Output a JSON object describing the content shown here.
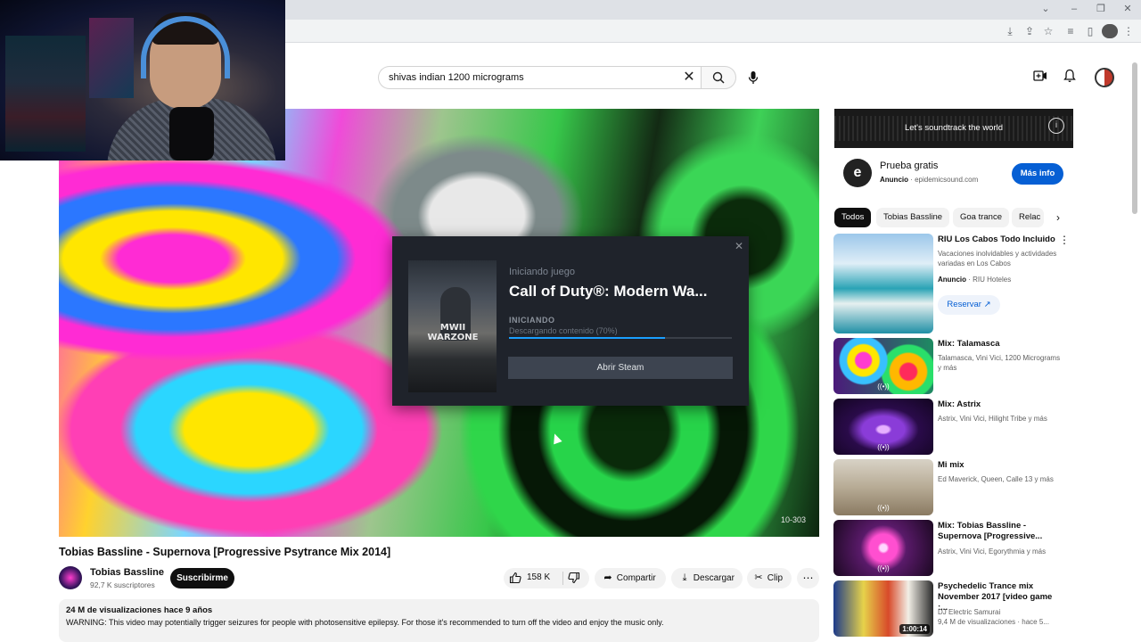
{
  "search": {
    "value": "shivas indian 1200 micrograms"
  },
  "player": {
    "watermark": "10-303"
  },
  "steam_dialog": {
    "status": "Iniciando juego",
    "title": "Call of Duty®: Modern Wa...",
    "state": "INICIANDO",
    "progress_text": "Descargando contenido (70%)",
    "progress_fraction": 0.7,
    "open_button": "Abrir Steam",
    "cover_logo": "MWII WARZONE"
  },
  "video": {
    "title": "Tobias Bassline - Supernova [Progressive Psytrance Mix 2014]",
    "channel_name": "Tobias Bassline",
    "subscribers": "92,7 K suscriptores",
    "subscribe_label": "Suscribirme",
    "likes": "158 K",
    "share_label": "Compartir",
    "download_label": "Descargar",
    "clip_label": "Clip",
    "views_meta": "24 M de visualizaciones  hace 9 años",
    "description": "WARNING: This video may potentially trigger seizures for people with photosensitive epilepsy. For those it's recommended to turn off the video and enjoy the music only."
  },
  "ad": {
    "banner_text": "Let's soundtrack the world",
    "title": "Prueba gratis",
    "label": "Anuncio",
    "domain": "epidemicsound.com",
    "button": "Más info"
  },
  "chips": [
    "Todos",
    "Tobias Bassline",
    "Goa trance",
    "Relac"
  ],
  "recommendations": [
    {
      "title": "RIU Los Cabos Todo Incluido",
      "sub1": "Vacaciones inolvidables y actividades variadas en Los Cabos",
      "sub2_label": "Anuncio",
      "sub2": "RIU Hoteles",
      "button": "Reservar"
    },
    {
      "title": "Mix: Talamasca",
      "sub1": "Talamasca, Vini Vici, 1200 Micrograms y más"
    },
    {
      "title": "Mix: Astrix",
      "sub1": "Astrix, Vini Vici, Hilight Tribe y más"
    },
    {
      "title": "Mi mix",
      "sub1": "Ed Maverick, Queen, Calle 13 y más"
    },
    {
      "title": "Mix: Tobias Bassline - Supernova [Progressive...",
      "sub1": "Astrix, Vini Vici, Egorythmia y más"
    },
    {
      "title": "Psychedelic Trance mix November 2017 [video game :...",
      "sub1": "DJ Electric Samurai",
      "sub2": "9,4 M de visualizaciones · hace 5...",
      "duration": "1:00:14"
    }
  ],
  "colors": {
    "accent": "#065fd4",
    "steam_bg": "#1f232b",
    "steam_progress": "#1a9fff"
  },
  "icons": [
    "search-icon",
    "mic-icon",
    "create-video-icon",
    "bell-icon",
    "like-icon",
    "dislike-icon",
    "share-icon",
    "download-icon",
    "scissors-icon",
    "more-icon",
    "info-icon",
    "chevron-right-icon",
    "external-link-icon",
    "mix-icon"
  ]
}
